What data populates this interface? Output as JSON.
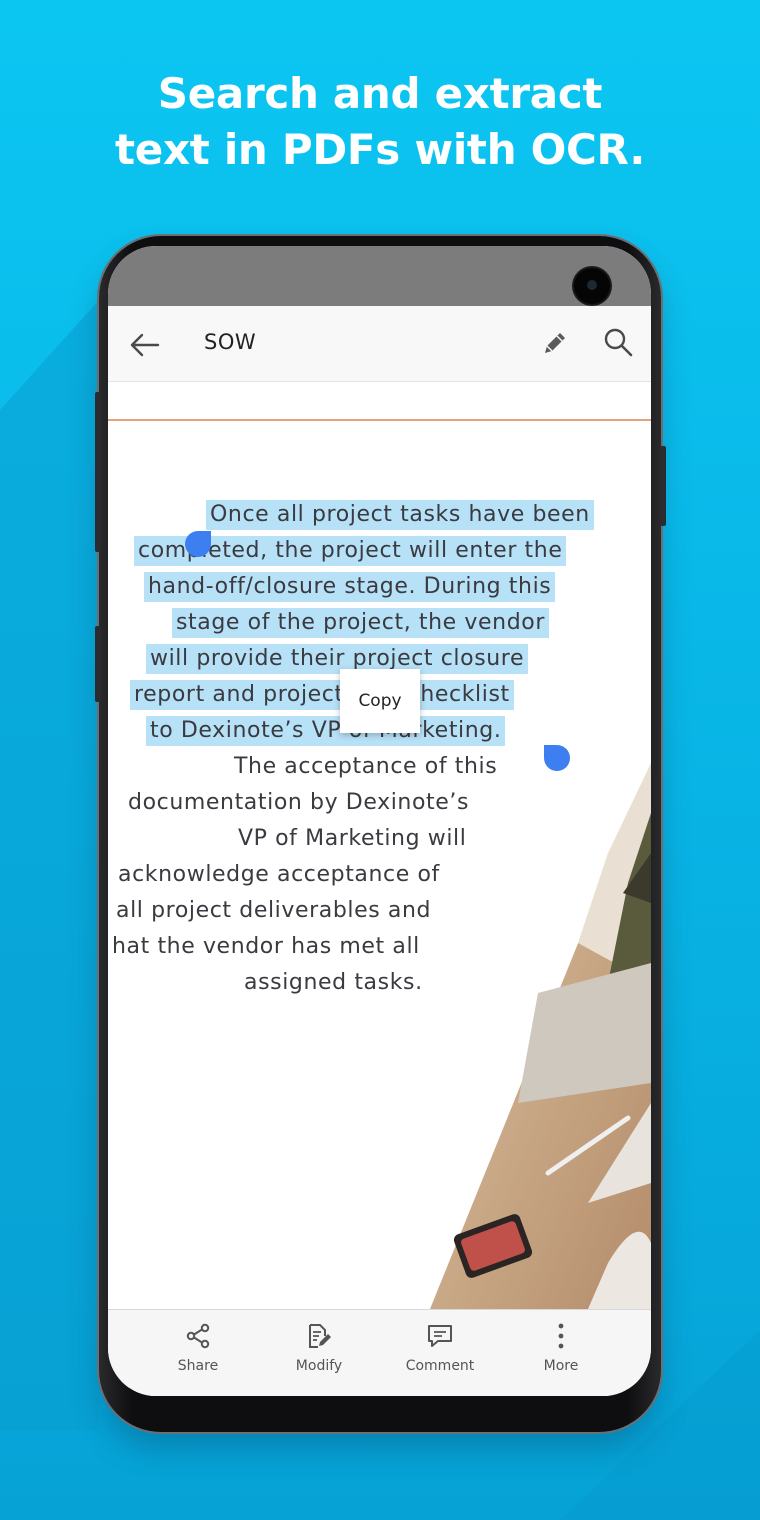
{
  "headline": {
    "line1": "Search and extract",
    "line2": "text in PDFs with OCR."
  },
  "colors": {
    "background": "#0bbdee",
    "selection": "#7ac8f0",
    "selection_handle": "#3d7ff0",
    "divider_rule": "#e2a27a"
  },
  "appbar": {
    "title": "SOW",
    "back_icon": "arrow-left-icon",
    "edit_icon": "pencil-icon",
    "search_icon": "search-icon"
  },
  "document": {
    "selected_lines": [
      "Once all project tasks have been",
      "completed, the project will enter the",
      "hand-off/closure stage. During this",
      "stage of the project, the vendor",
      "will provide their project closure",
      "report and project task checklist",
      "to Dexinote’s VP of Marketing."
    ],
    "unselected_lines": [
      "The acceptance of this",
      "documentation by Dexinote’s",
      "VP of Marketing will",
      "acknowledge acceptance of",
      "all project deliverables and",
      "hat the vendor has met all",
      "assigned tasks."
    ]
  },
  "context_menu": {
    "copy_label": "Copy"
  },
  "bottom_bar": {
    "items": [
      {
        "label": "Share",
        "icon": "share-icon"
      },
      {
        "label": "Modify",
        "icon": "edit-document-icon"
      },
      {
        "label": "Comment",
        "icon": "comment-icon"
      },
      {
        "label": "More",
        "icon": "more-vertical-icon"
      }
    ]
  }
}
